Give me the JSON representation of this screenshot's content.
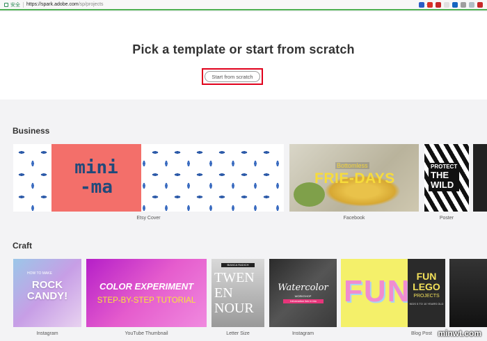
{
  "browser": {
    "secure_label": "安全",
    "url_host": "https://spark.adobe.com",
    "url_path": "/sp/projects"
  },
  "hero": {
    "title": "Pick a template or start from scratch",
    "scratch_button": "Start from scratch"
  },
  "sections": {
    "business": {
      "title": "Business",
      "cards": [
        {
          "caption": "Etsy Cover",
          "art_text": [
            "mini",
            "-ma"
          ]
        },
        {
          "caption": "Facebook",
          "art_text": [
            "Bottomless",
            "FRIE-DAYS"
          ]
        },
        {
          "caption": "Poster",
          "art_text": [
            "PROTECT",
            "THE",
            "WILD"
          ]
        }
      ]
    },
    "craft": {
      "title": "Craft",
      "cards": [
        {
          "caption": "Instagram",
          "art_text": [
            "ROCK",
            "CANDY!",
            "HOW TO MAKE"
          ]
        },
        {
          "caption": "YouTube Thumbnail",
          "art_text": [
            "COLOR EXPERIMENT",
            "STEP-BY-STEP TUTORIAL"
          ]
        },
        {
          "caption": "Letter Size",
          "art_text": [
            "BIANCA RADICH",
            "TWEN",
            "EN",
            "NOUR"
          ]
        },
        {
          "caption": "Instagram",
          "art_text": [
            "Watercolor",
            "WORKSHOP",
            "Information link in bio"
          ]
        },
        {
          "caption": "Blog Post",
          "art_text": [
            "FUN",
            "FUN",
            "LEGO",
            "PROJECTS",
            "KIDS 5 TO 10 YEARS OLD"
          ]
        }
      ]
    }
  },
  "watermark": "minwt.com",
  "colors": {
    "accent_border": "#e0001b",
    "page_bg": "#f3f3f5",
    "etsy_pink": "#f36f6a"
  },
  "icons": [
    "lock-icon",
    "star-icon",
    "extension-icon"
  ]
}
